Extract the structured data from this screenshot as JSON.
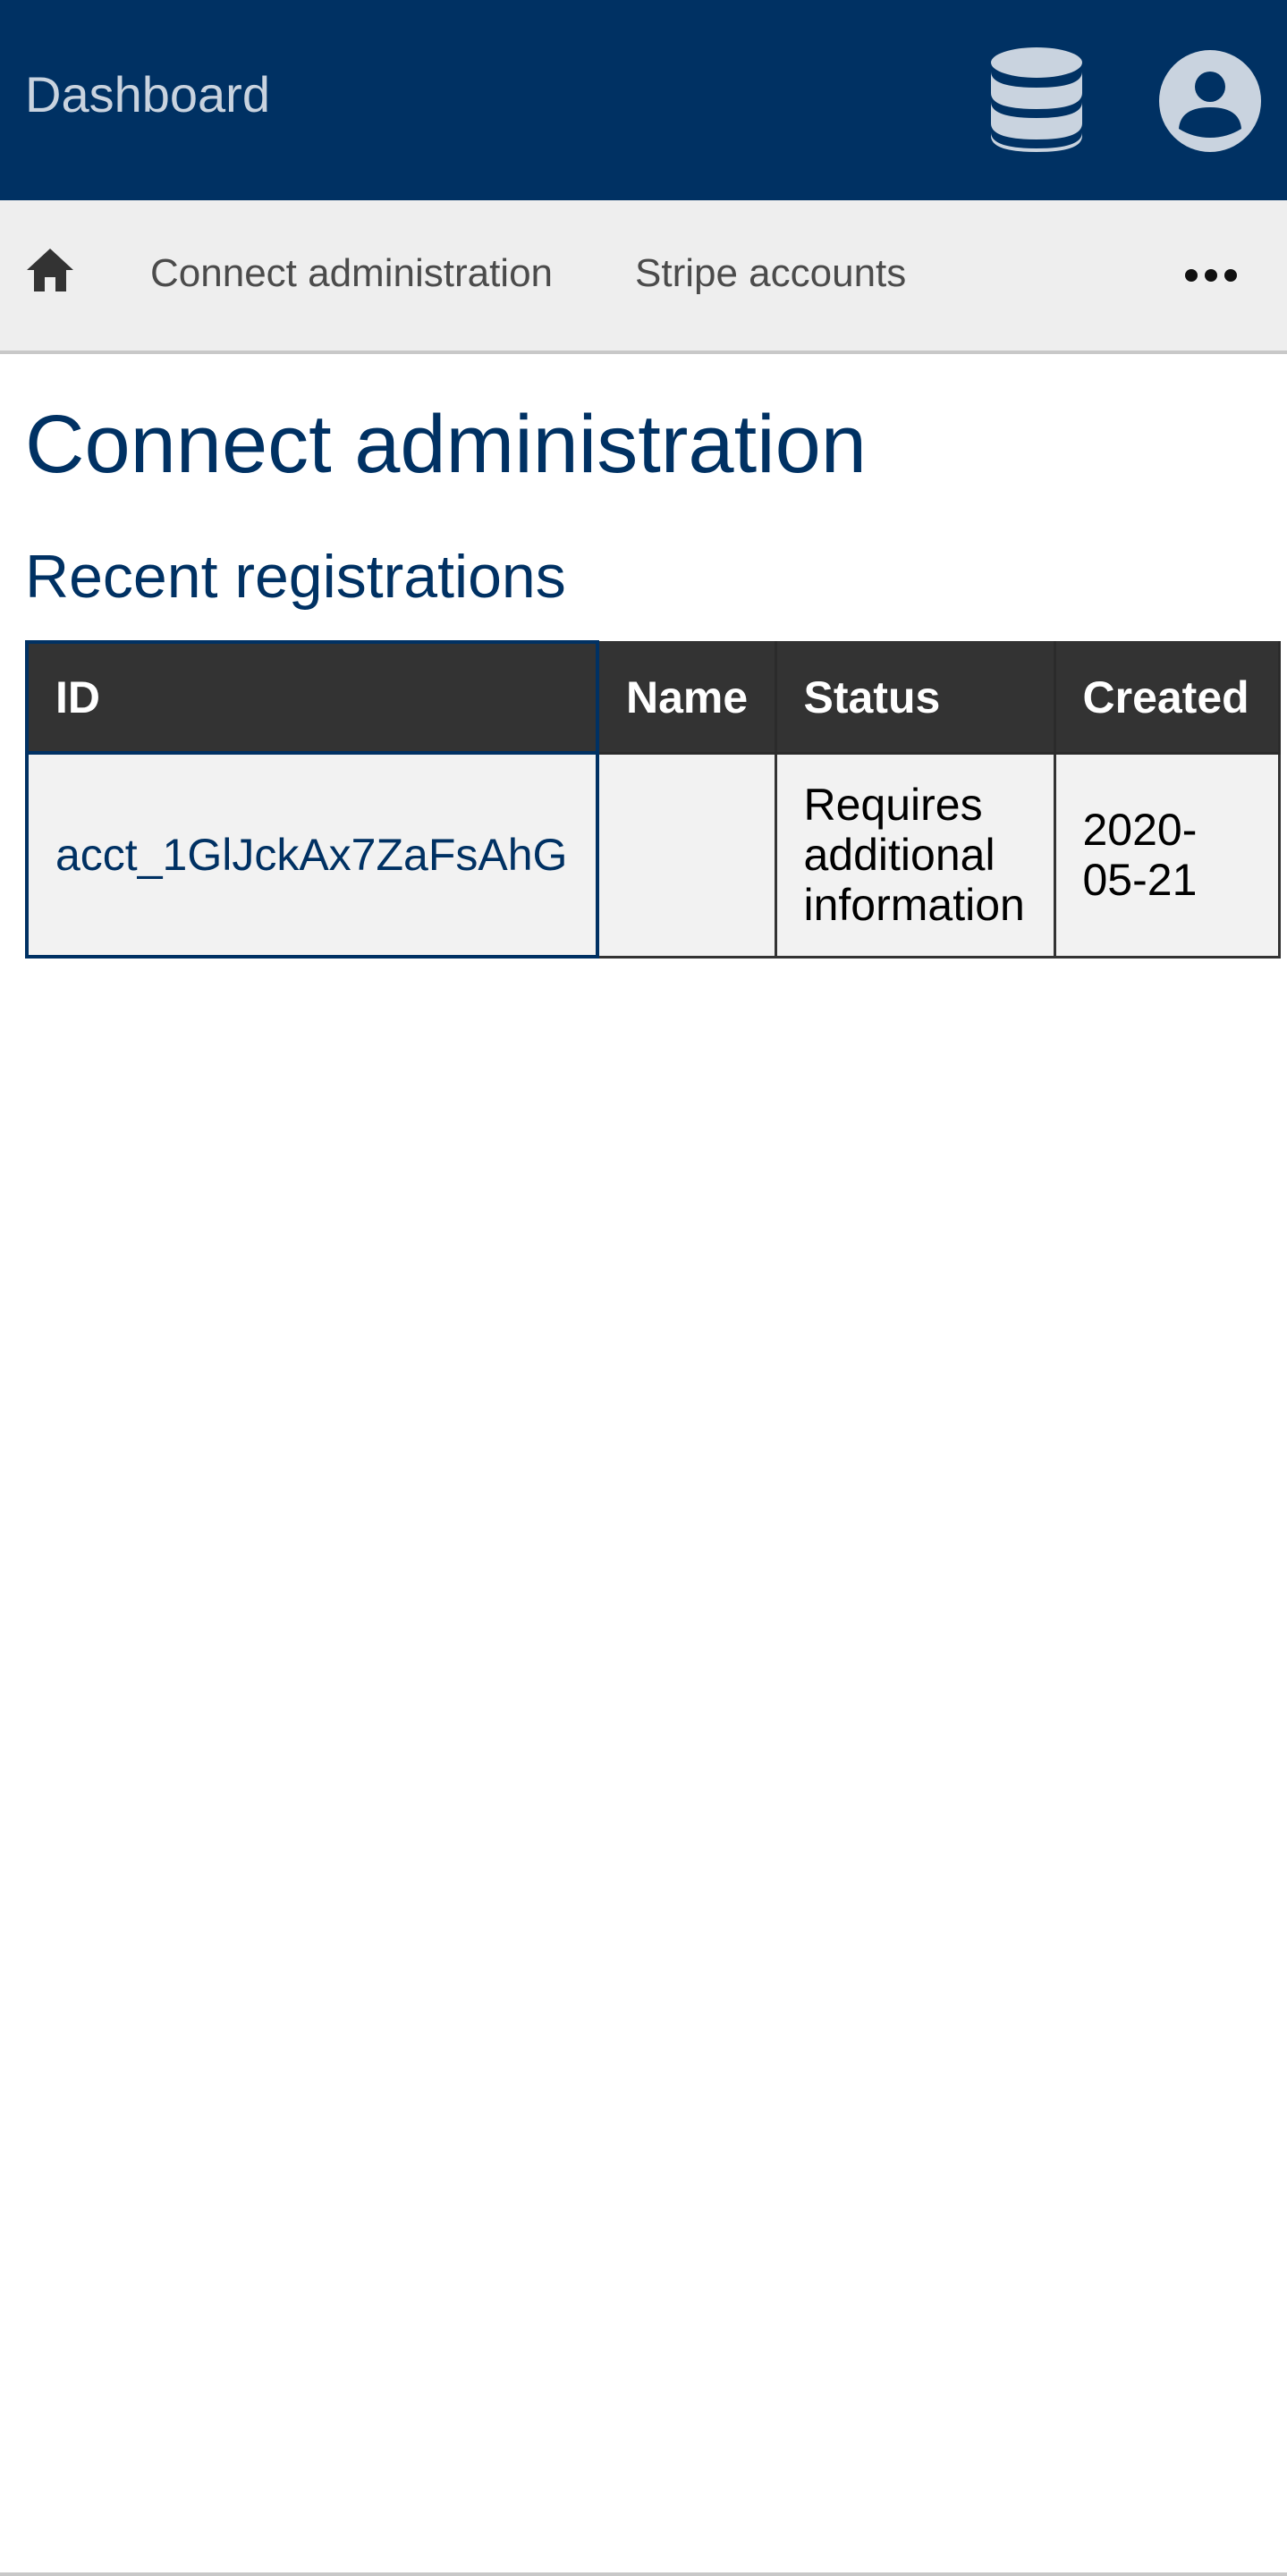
{
  "header": {
    "brand": "Dashboard",
    "icons": {
      "database": "database-icon",
      "account": "user-circle-icon"
    },
    "colors": {
      "background": "#003163",
      "brand_text": "#c9d3df",
      "icon": "#c9d3df"
    }
  },
  "nav": {
    "home_icon": "home-icon",
    "links": [
      {
        "label": "Connect administration"
      },
      {
        "label": "Stripe accounts"
      }
    ],
    "more_icon": "ellipsis-icon"
  },
  "page": {
    "title": "Connect administration",
    "section_title": "Recent registrations"
  },
  "table": {
    "headers": {
      "id": "ID",
      "name": "Name",
      "status": "Status",
      "created": "Created"
    },
    "rows": [
      {
        "id": "acct_1GlJckAx7ZaFsAhG",
        "name": "",
        "status": "Requires additional information",
        "created": "2020-05-21"
      }
    ]
  }
}
